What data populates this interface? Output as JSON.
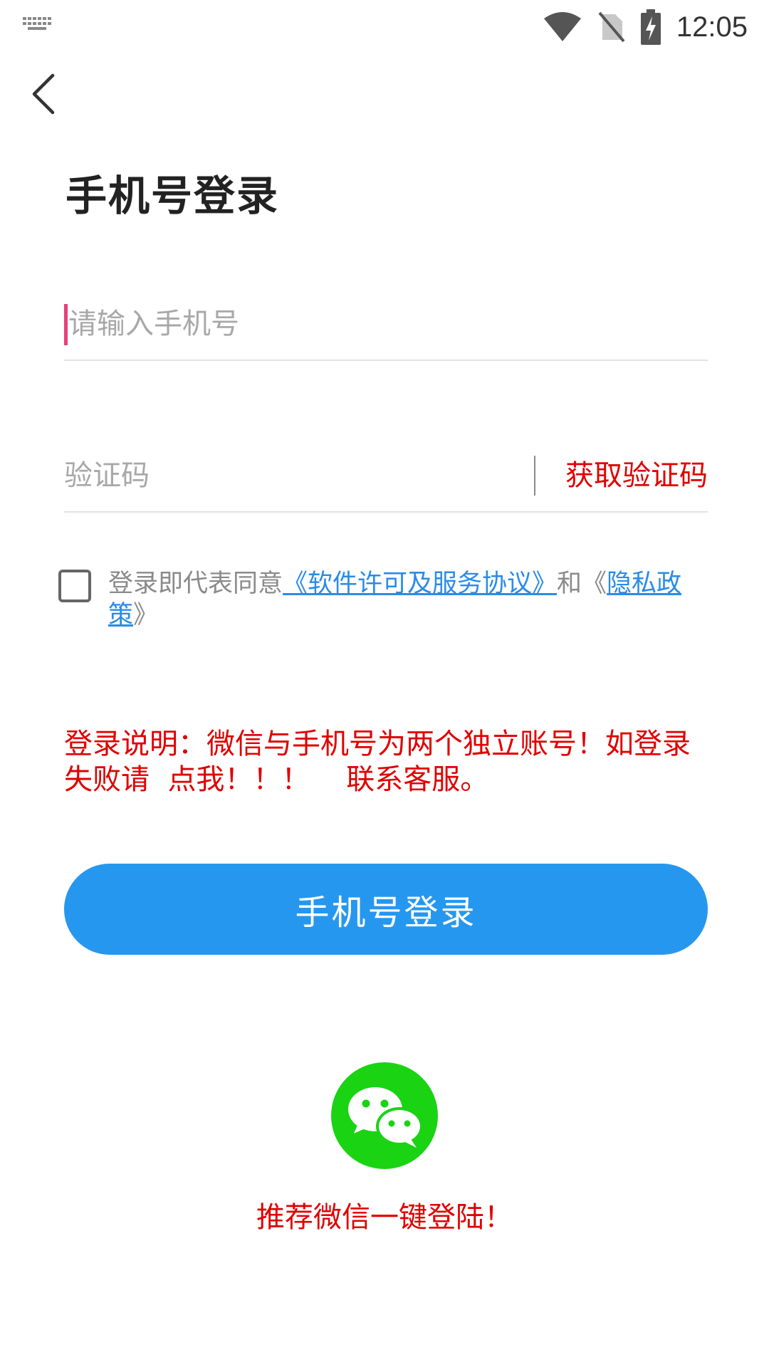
{
  "status_bar": {
    "time": "12:05",
    "icons": [
      "keyboard-icon",
      "wifi-icon",
      "no-sim-icon",
      "battery-charging-icon"
    ]
  },
  "header": {
    "back_icon": "chevron-left-icon"
  },
  "title": "手机号登录",
  "form": {
    "phone_placeholder": "请输入手机号",
    "code_placeholder": "验证码",
    "get_code_label": "获取验证码"
  },
  "agreement": {
    "checked": false,
    "prefix": "登录即代表同意",
    "license_link": "《软件许可及服务协议》",
    "joiner": "和《",
    "privacy_link": "隐私政策",
    "suffix": "》"
  },
  "notice": {
    "part1": "登录说明：微信与手机号为两个独立账号！如登录失败请",
    "part2": "点我！！！",
    "part3": "联系客服。"
  },
  "login_button_label": "手机号登录",
  "wechat": {
    "icon": "wechat-icon",
    "label": "推荐微信一键登陆！"
  },
  "colors": {
    "primary": "#2697ee",
    "warning": "#e00000",
    "link": "#2a8be8",
    "wechat": "#1ad313",
    "caret": "#e8407a"
  }
}
